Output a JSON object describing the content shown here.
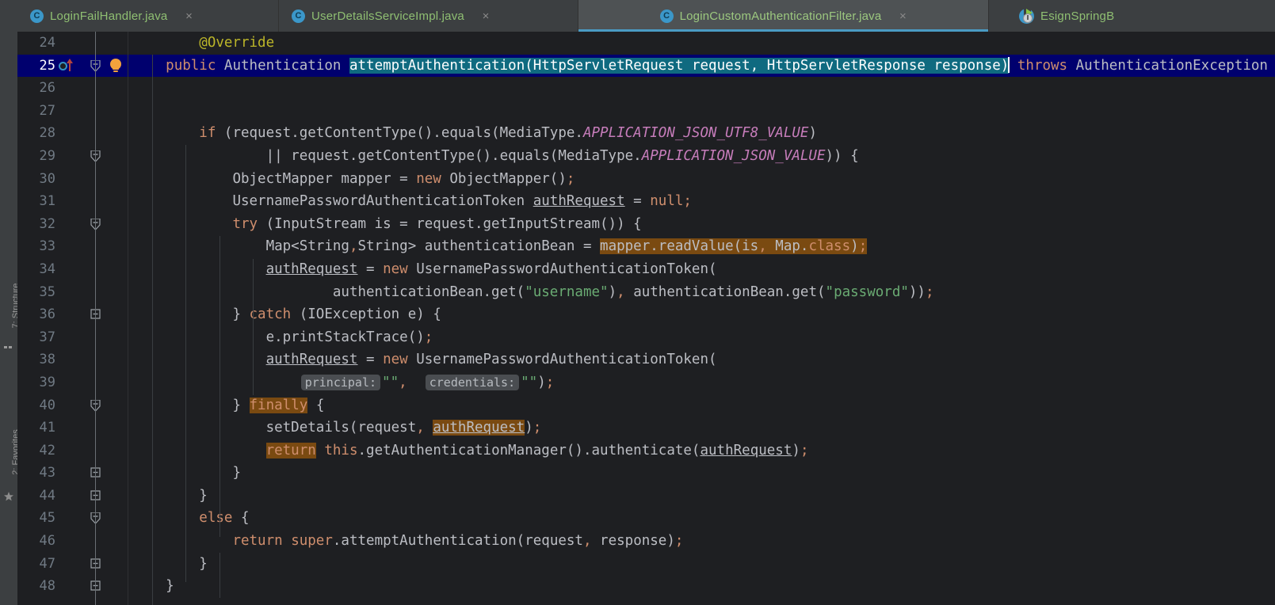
{
  "window": {
    "background": "#1e1f22",
    "chrome_background": "#3c3f41",
    "accent": "#4a9bc4"
  },
  "toolstrip": {
    "items": [
      {
        "label": "7: Structure",
        "icon": "structure-icon"
      },
      {
        "label": "2: Favorites",
        "icon": "star-icon"
      }
    ]
  },
  "tabs": [
    {
      "label": "LoginFailHandler.java",
      "icon": "java-class-icon",
      "close": "×",
      "active": false
    },
    {
      "label": "UserDetailsServiceImpl.java",
      "icon": "java-class-icon",
      "close": "×",
      "active": false
    },
    {
      "label": "LoginCustomAuthenticationFilter.java",
      "icon": "java-class-icon",
      "close": "×",
      "active": true
    },
    {
      "label": "EsignSpringB",
      "icon": "run-configuration-icon",
      "close": "",
      "active": false
    }
  ],
  "editor": {
    "language": "java",
    "current_line": 25,
    "caret_line": 25,
    "selection_text": "attemptAuthentication(HttpServletRequest request, HttpServletResponse response)",
    "first_visible_line": 24,
    "last_visible_line": 48,
    "line_numbers": [
      24,
      25,
      26,
      27,
      28,
      29,
      30,
      31,
      32,
      33,
      34,
      35,
      36,
      37,
      38,
      39,
      40,
      41,
      42,
      43,
      44,
      45,
      46,
      47,
      48
    ],
    "colors": {
      "current_line_bg": "#00006e",
      "selection_bg": "#0f6a80",
      "identifier_highlight_bg": "#7a4a11",
      "keyword": "#cf8e6d",
      "string": "#6aab73",
      "static_field": "#c77dbb",
      "text": "#bcbec4",
      "line_number": "#707a84"
    },
    "gutter_markers": {
      "override_line": 25,
      "intention_bulb_line": 25,
      "fold_lines": [
        25,
        29,
        32,
        36,
        40,
        43,
        44,
        45,
        47,
        48
      ]
    },
    "inlay_hints": [
      {
        "line": 39,
        "label": "principal:"
      },
      {
        "line": 39,
        "label": "credentials:"
      }
    ],
    "source_lines": [
      "    @Override",
      "    public Authentication attemptAuthentication(HttpServletRequest request, HttpServletResponse response) throws AuthenticationException",
      "",
      "",
      "        if (request.getContentType().equals(MediaType.APPLICATION_JSON_UTF8_VALUE)",
      "                || request.getContentType().equals(MediaType.APPLICATION_JSON_VALUE)) {",
      "            ObjectMapper mapper = new ObjectMapper();",
      "            UsernamePasswordAuthenticationToken authRequest = null;",
      "            try (InputStream is = request.getInputStream()) {",
      "                Map<String,String> authenticationBean = mapper.readValue(is, Map.class);",
      "                authRequest = new UsernamePasswordAuthenticationToken(",
      "                        authenticationBean.get(\"username\"), authenticationBean.get(\"password\"));",
      "            } catch (IOException e) {",
      "                e.printStackTrace();",
      "                authRequest = new UsernamePasswordAuthenticationToken(",
      "                        \"\", \"\");",
      "            } finally {",
      "                setDetails(request, authRequest);",
      "                return this.getAuthenticationManager().authenticate(authRequest);",
      "            }",
      "        }",
      "        else {",
      "            return super.attemptAuthentication(request, response);",
      "        }",
      "    }"
    ]
  }
}
